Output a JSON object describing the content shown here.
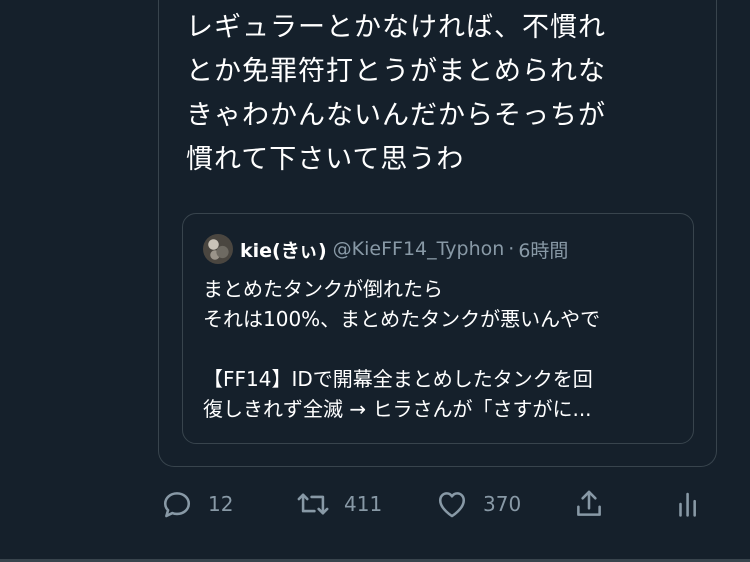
{
  "tweet": {
    "text": "レギュラーとかなければ、不慣れ\nとか免罪符打とうがまとめられな\nきゃわかんないんだからそっちが\n慣れて下さいて思うわ"
  },
  "quoted_tweet": {
    "author_name": "kie(きぃ)",
    "author_handle": "@KieFF14_Typhon",
    "separator": "·",
    "time": "6時間",
    "lines": [
      "まとめたタンクが倒れたら",
      "それは100%、まとめたタンクが悪いんやで",
      "【FF14】IDで開幕全まとめしたタンクを回",
      "復しきれず全滅 → ヒラさんが「さすがに..."
    ]
  },
  "actions": {
    "reply_count": "12",
    "retweet_count": "411",
    "like_count": "370"
  },
  "colors": {
    "background": "#15202b",
    "border": "#38444d",
    "secondary_text": "#8899a6",
    "primary_text": "#ffffff"
  },
  "icons": {
    "reply": "reply-icon",
    "retweet": "retweet-icon",
    "like": "heart-icon",
    "share": "share-icon",
    "analytics": "analytics-icon"
  }
}
